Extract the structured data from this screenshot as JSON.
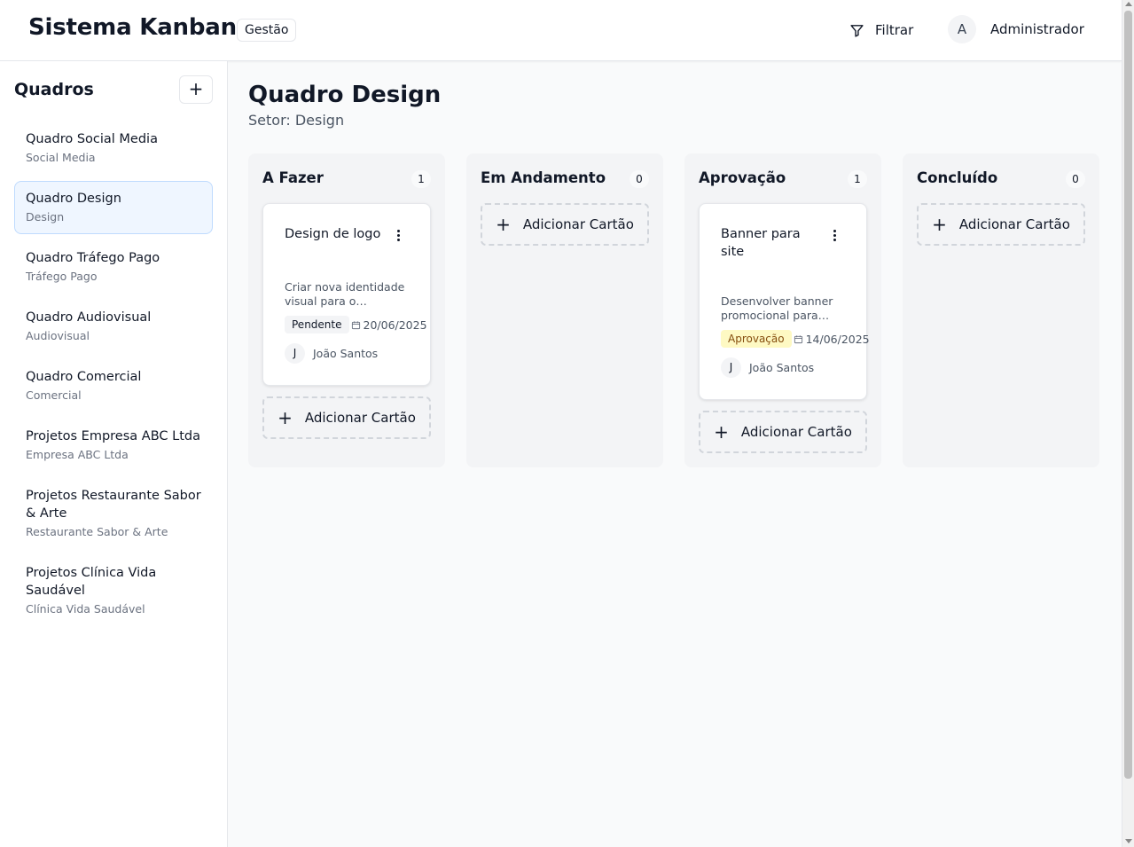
{
  "header": {
    "app_title": "Sistema Kanban",
    "app_badge": "Gestão",
    "filter_label": "Filtrar",
    "user_initial": "A",
    "user_name": "Administrador"
  },
  "sidebar": {
    "title": "Quadros",
    "add_label": "+",
    "items": [
      {
        "name": "Quadro Social Media",
        "sector": "Social Media",
        "active": false
      },
      {
        "name": "Quadro Design",
        "sector": "Design",
        "active": true
      },
      {
        "name": "Quadro Tráfego Pago",
        "sector": "Tráfego Pago",
        "active": false
      },
      {
        "name": "Quadro Audiovisual",
        "sector": "Audiovisual",
        "active": false
      },
      {
        "name": "Quadro Comercial",
        "sector": "Comercial",
        "active": false
      },
      {
        "name": "Projetos Empresa ABC Ltda",
        "sector": "Empresa ABC Ltda",
        "active": false
      },
      {
        "name": "Projetos Restaurante Sabor & Arte",
        "sector": "Restaurante Sabor & Arte",
        "active": false
      },
      {
        "name": "Projetos Clínica Vida Saudável",
        "sector": "Clínica Vida Saudável",
        "active": false
      }
    ]
  },
  "main": {
    "title": "Quadro Design",
    "subtitle": "Setor: Design",
    "add_card_label": "Adicionar Cartão",
    "add_card_icon": "+",
    "columns": [
      {
        "title": "A Fazer",
        "count": "1",
        "card": {
          "title": "Design de logo",
          "description": "Criar nova identidade visual para o…",
          "status": "Pendente",
          "date": "20/06/2025",
          "assignee_initial": "J",
          "assignee_name": "João Santos"
        }
      },
      {
        "title": "Em Andamento",
        "count": "0"
      },
      {
        "title": "Aprovação",
        "count": "1",
        "card": {
          "title": "Banner para site",
          "description": "Desenvolver banner promocional para…",
          "status": "Aprovação",
          "date": "14/06/2025",
          "assignee_initial": "J",
          "assignee_name": "João Santos"
        }
      },
      {
        "title": "Concluído",
        "count": "0"
      }
    ]
  }
}
